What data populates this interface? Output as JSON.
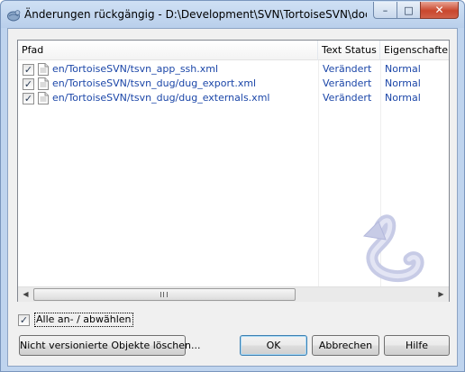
{
  "window": {
    "title": "Änderungen rückgängig - D:\\Development\\SVN\\TortoiseSVN\\doc\\so...",
    "controls": {
      "minimize": "–",
      "maximize": "□",
      "close": "✕"
    }
  },
  "columns": [
    "Pfad",
    "Text Status",
    "Eigenschaften"
  ],
  "rows": [
    {
      "checked": "✓",
      "path": "en/TortoiseSVN/tsvn_app_ssh.xml",
      "text_status": "Verändert",
      "property_status": "Normal"
    },
    {
      "checked": "✓",
      "path": "en/TortoiseSVN/tsvn_dug/dug_export.xml",
      "text_status": "Verändert",
      "property_status": "Normal"
    },
    {
      "checked": "✓",
      "path": "en/TortoiseSVN/tsvn_dug/dug_externals.xml",
      "text_status": "Verändert",
      "property_status": "Normal"
    }
  ],
  "scrollbar": {
    "left_arrow": "◀",
    "right_arrow": "▶"
  },
  "select_all": {
    "checked": "✓",
    "label": "Alle an- / abwählen"
  },
  "buttons": {
    "delete_unversioned": "Nicht versionierte Objekte löschen...",
    "ok": "OK",
    "cancel": "Abbrechen",
    "help": "Hilfe"
  },
  "colors": {
    "link_text": "#1b46a8",
    "client_bg": "#f0f0f0",
    "title_bg": "#bfd4ee"
  },
  "icons": {
    "app": "tortoisesvn-icon",
    "file": "xml-file-icon",
    "watermark": "revert-arrow-icon"
  }
}
